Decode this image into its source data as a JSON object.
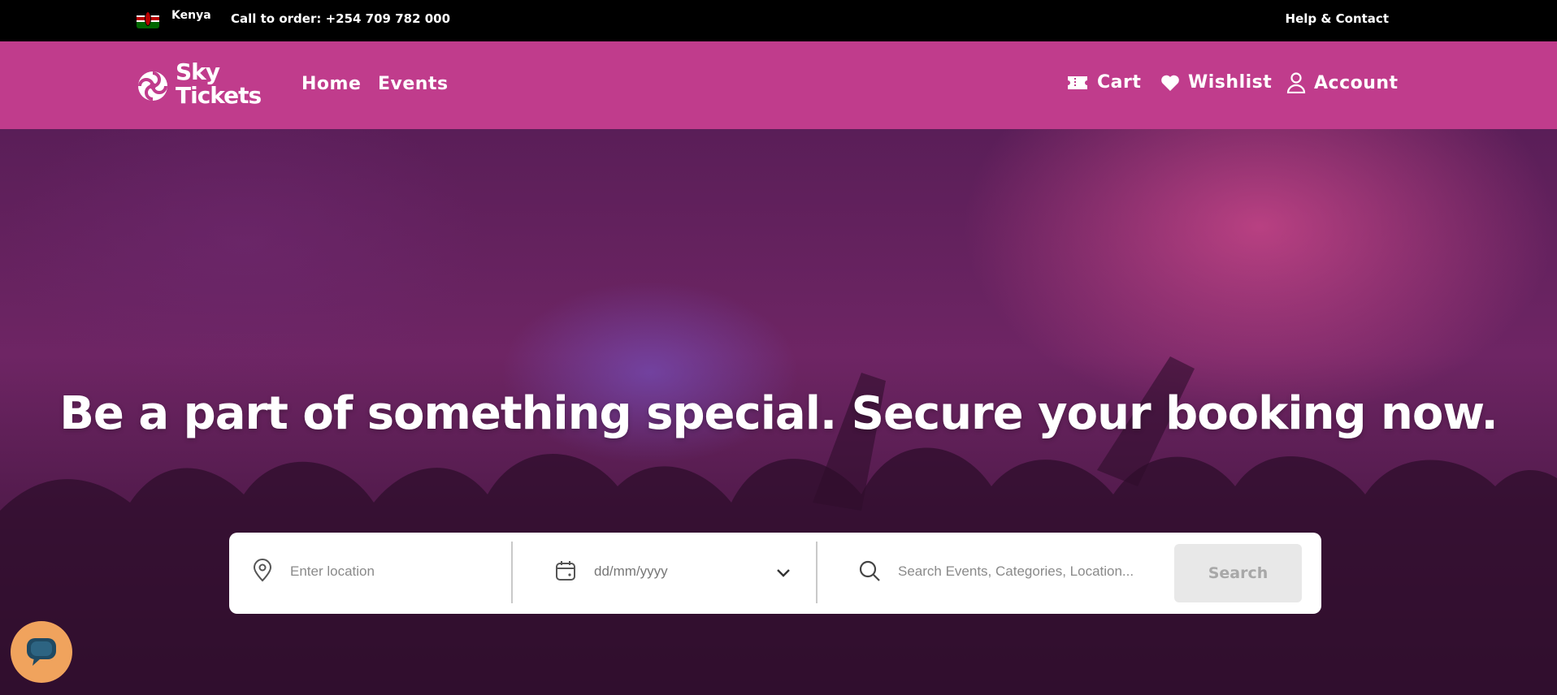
{
  "topbar": {
    "country": "Kenya",
    "phone": "Call to order: +254 709 782 000",
    "help": "Help & Contact"
  },
  "nav": {
    "logo_line1": "Sky",
    "logo_line2": "Tickets",
    "home": "Home",
    "events": "Events",
    "cart": "Cart",
    "wishlist": "Wishlist",
    "account": "Account"
  },
  "hero": {
    "headline": "Be a part of something special. Secure your booking now."
  },
  "search": {
    "location_placeholder": "Enter location",
    "date_placeholder": "dd/mm/yyyy",
    "query_placeholder": "Search Events, Categories, Location...",
    "button": "Search"
  },
  "colors": {
    "brand": "#c03c8c",
    "topbar": "#000000",
    "chat": "#f0a35d"
  },
  "icons": [
    "kenya-flag-icon",
    "logo-icon",
    "ticket-icon",
    "heart-icon",
    "user-icon",
    "location-pin-icon",
    "calendar-icon",
    "chevron-down-icon",
    "search-icon",
    "chat-icon"
  ]
}
